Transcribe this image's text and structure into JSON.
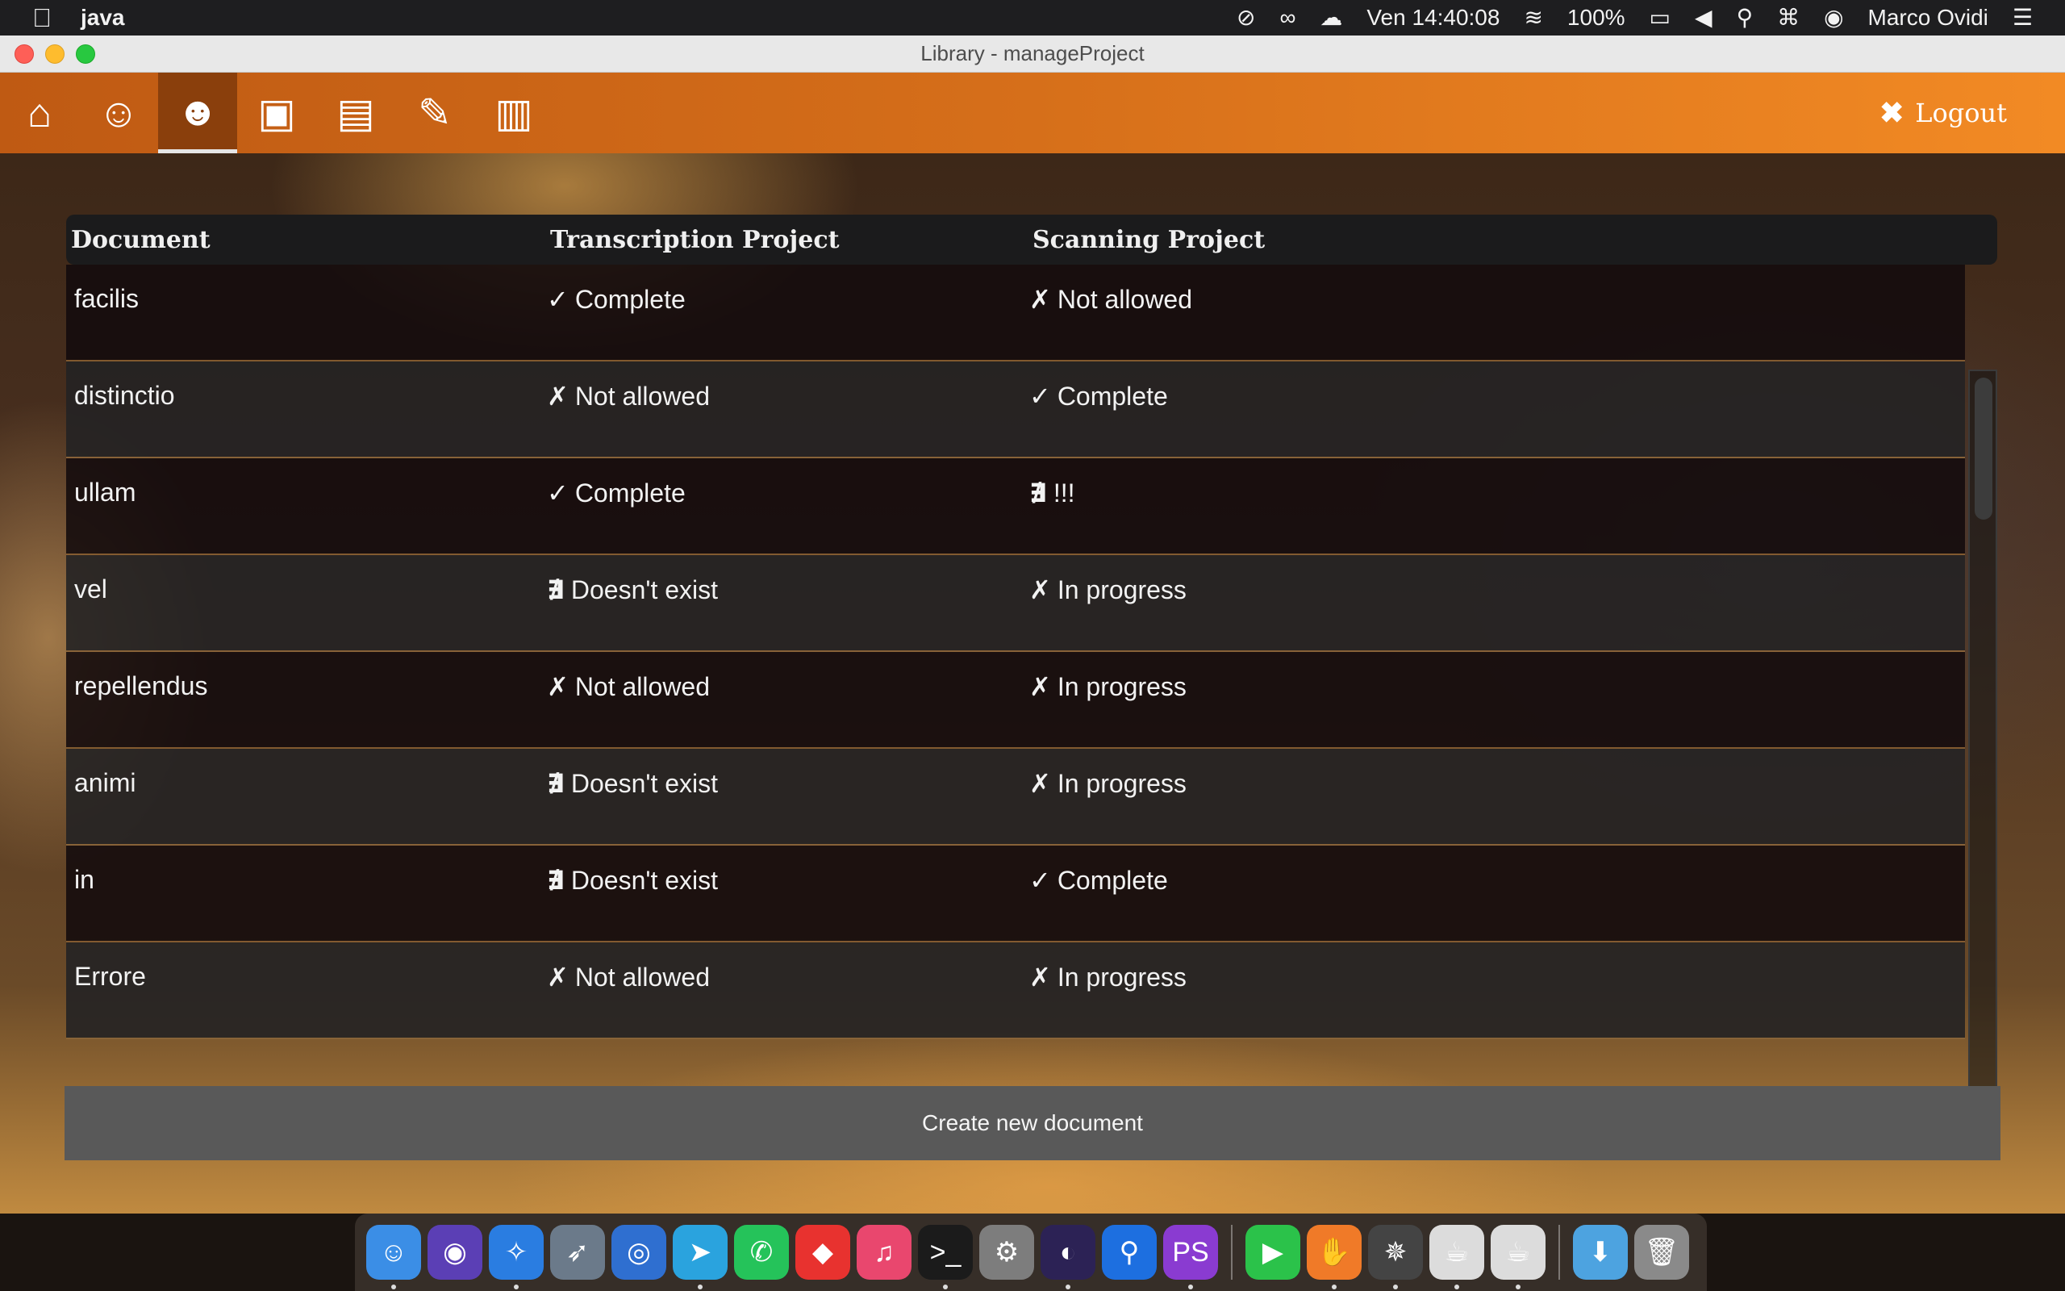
{
  "menubar": {
    "app_name": "java",
    "clock": "Ven 14:40:08",
    "battery": "100%",
    "user": "Marco Ovidi"
  },
  "window": {
    "title": "Library - manageProject"
  },
  "toolbar": {
    "buttons": [
      {
        "name": "home",
        "icon": "home-icon",
        "glyph": "⌂"
      },
      {
        "name": "account",
        "icon": "user-icon",
        "glyph": "☺"
      },
      {
        "name": "users",
        "icon": "users-icon",
        "glyph": "☻"
      },
      {
        "name": "images",
        "icon": "image-icon",
        "glyph": "▣"
      },
      {
        "name": "documents",
        "icon": "file-icon",
        "glyph": "▤"
      },
      {
        "name": "edit",
        "icon": "edit-icon",
        "glyph": "✎"
      },
      {
        "name": "projects",
        "icon": "briefcase-icon",
        "glyph": "▥"
      }
    ],
    "logout_label": "Logout",
    "logout_glyph": "✖"
  },
  "table": {
    "headers": [
      "Document",
      "Transcription Project",
      "Scanning Project"
    ],
    "rows": [
      {
        "document": "facilis",
        "transcription_icon": "✓",
        "transcription": "Complete",
        "scanning_icon": "✗",
        "scanning": "Not allowed"
      },
      {
        "document": "distinctio",
        "transcription_icon": "✗",
        "transcription": "Not allowed",
        "scanning_icon": "✓",
        "scanning": "Complete"
      },
      {
        "document": "ullam",
        "transcription_icon": "✓",
        "transcription": "Complete",
        "scanning_icon": "∄",
        "scanning": "!!!"
      },
      {
        "document": "vel",
        "transcription_icon": "∄",
        "transcription": "Doesn't exist",
        "scanning_icon": "✗",
        "scanning": "In progress"
      },
      {
        "document": "repellendus",
        "transcription_icon": "✗",
        "transcription": "Not allowed",
        "scanning_icon": "✗",
        "scanning": "In progress"
      },
      {
        "document": "animi",
        "transcription_icon": "∄",
        "transcription": "Doesn't exist",
        "scanning_icon": "✗",
        "scanning": "In progress"
      },
      {
        "document": "in",
        "transcription_icon": "∄",
        "transcription": "Doesn't exist",
        "scanning_icon": "✓",
        "scanning": "Complete"
      },
      {
        "document": "Errore",
        "transcription_icon": "✗",
        "transcription": "Not allowed",
        "scanning_icon": "✗",
        "scanning": "In progress"
      }
    ]
  },
  "create_button_label": "Create new document",
  "colors": {
    "toolbar_start": "#bf5a13",
    "toolbar_end": "#f28a24",
    "button_bg": "#595959"
  },
  "dock": {
    "items": [
      {
        "name": "finder",
        "icon": "finder-icon",
        "glyph": "☺",
        "bg": "#3b8ee6",
        "running": true
      },
      {
        "name": "siri",
        "icon": "siri-icon",
        "glyph": "◉",
        "bg": "#5b3fb5",
        "running": false
      },
      {
        "name": "safari",
        "icon": "safari-icon",
        "glyph": "✧",
        "bg": "#2a7de1",
        "running": true
      },
      {
        "name": "launchpad",
        "icon": "rocket-icon",
        "glyph": "➶",
        "bg": "#6b7a8a",
        "running": false
      },
      {
        "name": "mail-client",
        "icon": "apple-icon",
        "glyph": "◎",
        "bg": "#2f6fd0",
        "running": false
      },
      {
        "name": "telegram",
        "icon": "telegram-icon",
        "glyph": "➤",
        "bg": "#2aa3de",
        "running": true
      },
      {
        "name": "whatsapp",
        "icon": "whatsapp-icon",
        "glyph": "✆",
        "bg": "#25c35a",
        "running": false
      },
      {
        "name": "anydesk",
        "icon": "anydesk-icon",
        "glyph": "◆",
        "bg": "#e8322f",
        "running": false
      },
      {
        "name": "itunes",
        "icon": "music-icon",
        "glyph": "♫",
        "bg": "#e9476e",
        "running": false
      },
      {
        "name": "terminal",
        "icon": "terminal-icon",
        "glyph": ">_",
        "bg": "#1b1b1b",
        "running": true
      },
      {
        "name": "system-preferences",
        "icon": "gear-icon",
        "glyph": "⚙",
        "bg": "#7d7d7d",
        "running": false
      },
      {
        "name": "eclipse",
        "icon": "eclipse-icon",
        "glyph": "◐",
        "bg": "#2c2255",
        "running": true
      },
      {
        "name": "sourcetree",
        "icon": "sourcetree-icon",
        "glyph": "⚲",
        "bg": "#1d6fe0",
        "running": false
      },
      {
        "name": "phpstorm",
        "icon": "phpstorm-icon",
        "glyph": "PS",
        "bg": "#8a3bd1",
        "running": true
      },
      {
        "name": "facetime",
        "icon": "facetime-icon",
        "glyph": "▶",
        "bg": "#2bc24a",
        "running": false
      },
      {
        "name": "handy-app",
        "icon": "hand-icon",
        "glyph": "✋",
        "bg": "#f07a28",
        "running": true
      },
      {
        "name": "compass-app",
        "icon": "compass-icon",
        "glyph": "✵",
        "bg": "#444444",
        "running": true
      },
      {
        "name": "java-app-1",
        "icon": "coffee-icon",
        "glyph": "☕",
        "bg": "#dcdcdc",
        "running": true
      },
      {
        "name": "java-app-2",
        "icon": "coffee-icon",
        "glyph": "☕",
        "bg": "#dcdcdc",
        "running": true
      },
      {
        "name": "downloads",
        "icon": "folder-icon",
        "glyph": "⬇",
        "bg": "#4da3e0",
        "running": false
      },
      {
        "name": "trash",
        "icon": "trash-icon",
        "glyph": "🗑",
        "bg": "#8a8a8a",
        "running": false
      }
    ]
  }
}
